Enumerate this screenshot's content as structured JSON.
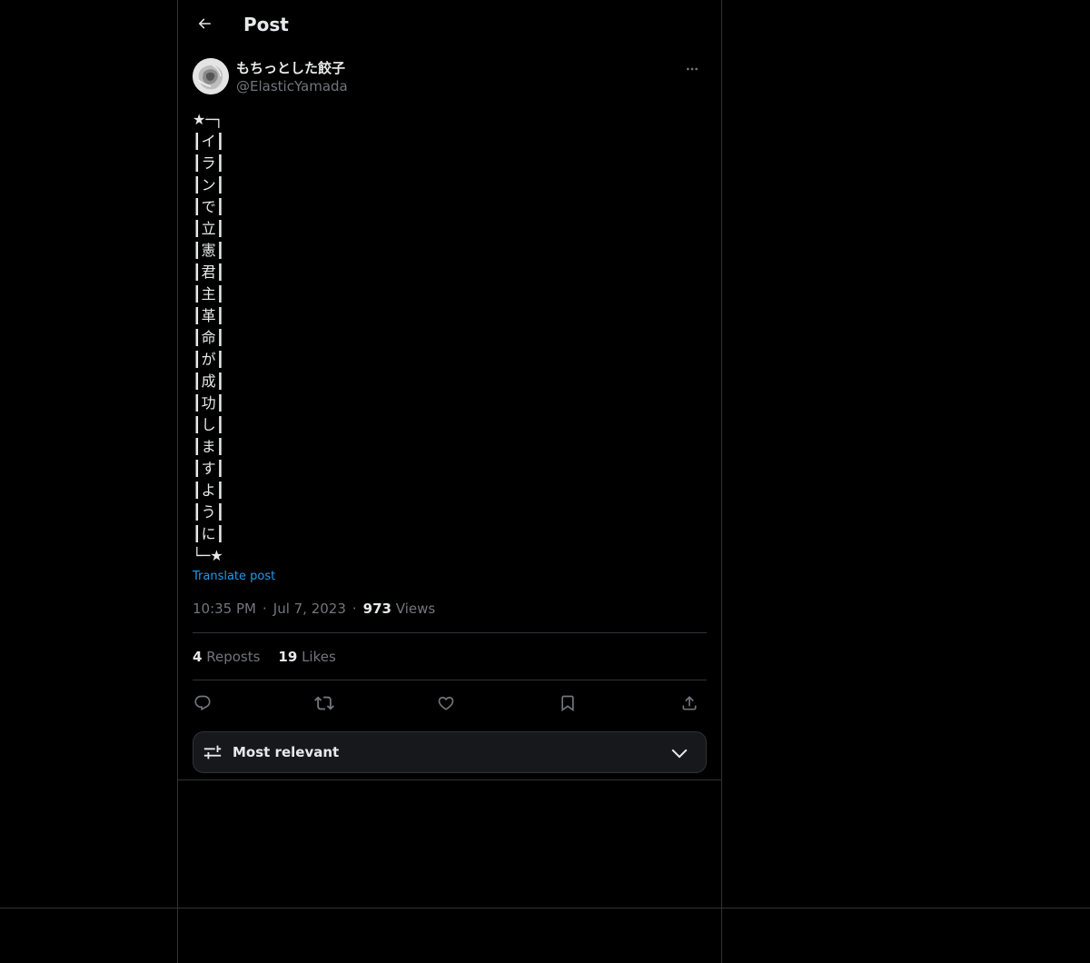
{
  "header": {
    "title": "Post"
  },
  "author": {
    "display_name": "もちっとした餃子",
    "handle": "@ElasticYamada"
  },
  "post": {
    "lines": [
      "★─┐",
      "┃イ┃",
      "┃ラ┃",
      "┃ン┃",
      "┃で┃",
      "┃立┃",
      "┃憲┃",
      "┃君┃",
      "┃主┃",
      "┃革┃",
      "┃命┃",
      "┃が┃",
      "┃成┃",
      "┃功┃",
      "┃し┃",
      "┃ま┃",
      "┃す┃",
      "┃よ┃",
      "┃う┃",
      "┃に┃",
      "└─★"
    ],
    "translate_label": "Translate post",
    "time": "10:35 PM",
    "date": "Jul 7, 2023",
    "views_count": "973",
    "views_label": "Views"
  },
  "stats": {
    "reposts_count": "4",
    "reposts_label": "Reposts",
    "likes_count": "19",
    "likes_label": "Likes"
  },
  "actions": {
    "icons": [
      "reply-icon",
      "repost-icon",
      "like-icon",
      "bookmark-icon",
      "share-icon"
    ]
  },
  "sort": {
    "label": "Most relevant"
  },
  "colors": {
    "background": "#000000",
    "text": "#e7e9ea",
    "muted": "#71767b",
    "link": "#1d9bf0",
    "border": "#2f3336"
  }
}
